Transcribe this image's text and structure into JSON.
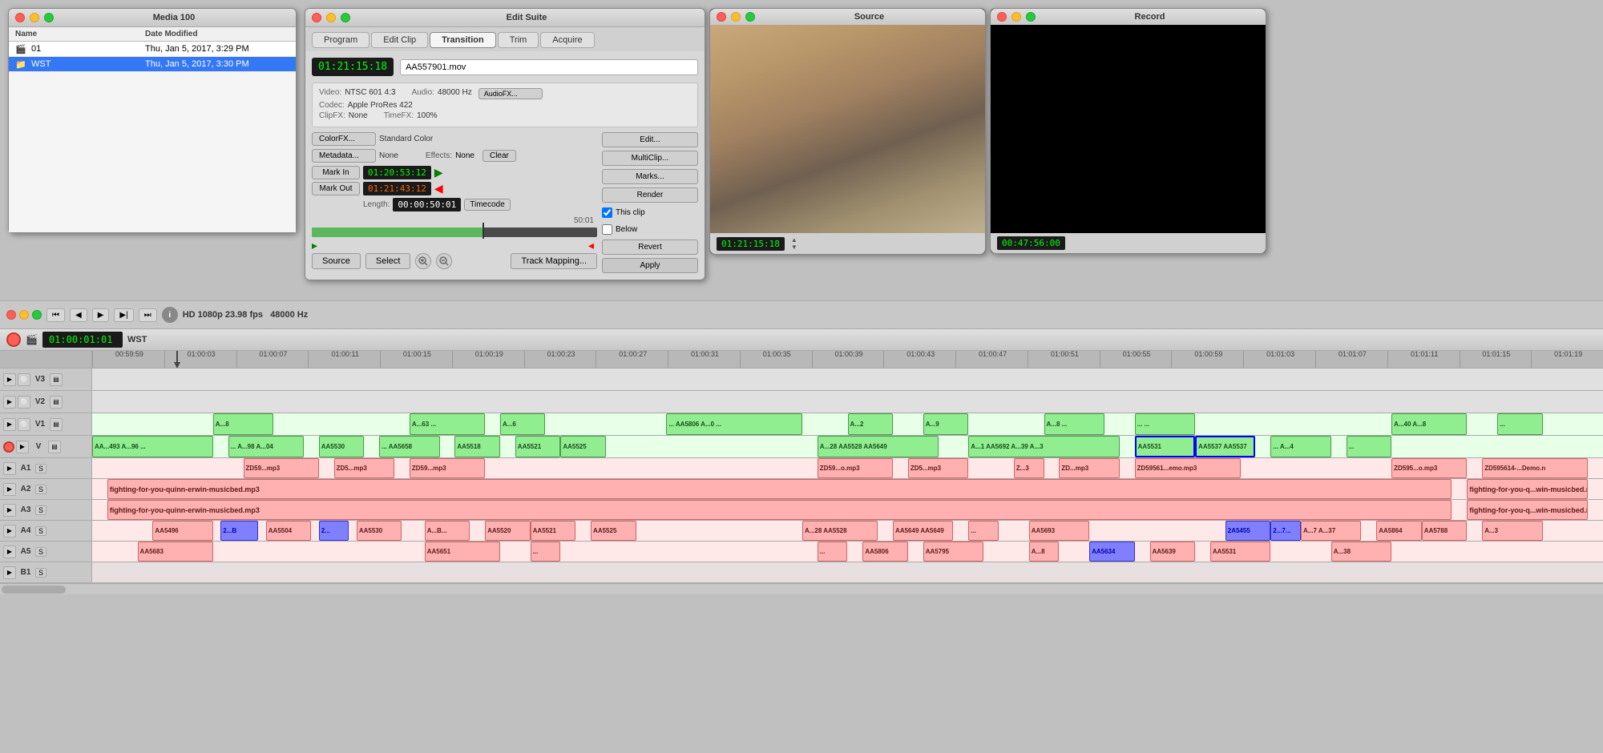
{
  "media_panel": {
    "title": "Media 100",
    "cols": [
      "Name",
      "Date Modified"
    ],
    "items": [
      {
        "name": "01",
        "date": "Thu, Jan 5, 2017, 3:29 PM",
        "type": "clip"
      },
      {
        "name": "WST",
        "date": "Thu, Jan 5, 2017, 3:30 PM",
        "type": "folder",
        "selected": true
      }
    ]
  },
  "edit_suite": {
    "title": "Edit Suite",
    "tabs": [
      "Program",
      "Edit Clip",
      "Transition",
      "Trim",
      "Acquire"
    ],
    "active_tab": "Transition",
    "timecode": "01:21:15:18",
    "clip_name": "AA557901.mov",
    "video_info": "NTSC 601 4:3",
    "codec": "Apple ProRes 422",
    "clip_fx": "None",
    "audio": "48000 Hz",
    "time_fx": "100%",
    "color_fx_label": "ColorFX...",
    "color_fx_value": "Standard Color",
    "metadata_label": "Metadata...",
    "metadata_value": "None",
    "effects_label": "Effects:",
    "effects_value": "None",
    "clear_label": "Clear",
    "mark_in_label": "Mark In",
    "mark_in_tc": "01:20:53:12",
    "mark_out_label": "Mark Out",
    "mark_out_tc": "01:21:43:12",
    "length_label": "Length:",
    "length_tc": "00:00:50:01",
    "timecode_type": "Timecode",
    "scrubber_max": "50:01",
    "source_label": "Source",
    "select_label": "Select",
    "track_mapping_label": "Track Mapping...",
    "audio_fx_label": "AudioFX...",
    "edit_label": "Edit...",
    "multiclip_label": "MultiClip...",
    "marks_label": "Marks...",
    "render_label": "Render",
    "this_clip_label": "This clip",
    "below_label": "Below",
    "revert_label": "Revert",
    "apply_label": "Apply"
  },
  "source_monitor": {
    "title": "Source",
    "timecode": "01:21:15:18"
  },
  "record_monitor": {
    "title": "Record",
    "timecode": "00:47:56:00"
  },
  "timeline": {
    "title": "WST",
    "format": "HD 1080p 23.98 fps",
    "audio_rate": "48000 Hz",
    "timecode": "01:00:01:01",
    "ruler_marks": [
      "00:59:59",
      "01:00:03",
      "01:00:07",
      "01:00:11",
      "01:00:15",
      "01:00:19",
      "01:00:23",
      "01:00:27",
      "01:00:31",
      "01:00:35",
      "01:00:39",
      "01:00:43",
      "01:00:47",
      "01:00:51",
      "01:00:55",
      "01:00:59",
      "01:01:03",
      "01:01:07",
      "01:01:11",
      "01:01:15",
      "01:01:19"
    ],
    "tracks": [
      {
        "name": "V3",
        "type": "v",
        "clips": []
      },
      {
        "name": "V2",
        "type": "v",
        "clips": []
      },
      {
        "name": "V1",
        "type": "v",
        "clips": [
          {
            "label": "A...8",
            "color": "green",
            "left": "20%",
            "width": "4%"
          },
          {
            "label": "A...63 ...",
            "color": "green",
            "left": "36%",
            "width": "4%"
          },
          {
            "label": "A...6",
            "color": "green",
            "left": "41%",
            "width": "3%"
          },
          {
            "label": "... AA5806 A...0 ... ... A...2",
            "color": "green",
            "left": "52%",
            "width": "8%"
          },
          {
            "label": "A...9",
            "color": "green",
            "left": "61%",
            "width": "3%"
          },
          {
            "label": "A...8 ...",
            "color": "green",
            "left": "68%",
            "width": "5%"
          },
          {
            "label": "... ...",
            "color": "green",
            "left": "74%",
            "width": "3%"
          },
          {
            "label": "A...40 A...8",
            "color": "green",
            "left": "86%",
            "width": "5%"
          },
          {
            "label": "...",
            "color": "green",
            "left": "92%",
            "width": "3%"
          }
        ]
      },
      {
        "name": "V",
        "type": "v",
        "record": true,
        "clips": [
          {
            "label": "AA... A...493 A...96 ...",
            "color": "green",
            "left": "0%",
            "width": "14%"
          },
          {
            "label": "... A...98 A...04",
            "color": "green",
            "left": "14%",
            "width": "5%"
          },
          {
            "label": "AA5530",
            "color": "green",
            "left": "21%",
            "width": "4%"
          },
          {
            "label": "... AA5658 ...",
            "color": "green",
            "left": "26%",
            "width": "4%"
          },
          {
            "label": "AA5518",
            "color": "green",
            "left": "30%",
            "width": "3%"
          },
          {
            "label": "AA5521",
            "color": "green",
            "left": "33%",
            "width": "3%"
          },
          {
            "label": "AA5525",
            "color": "green",
            "left": "37%",
            "width": "3%"
          },
          {
            "label": "A...28 AA5528 AA5649",
            "color": "green",
            "left": "53%",
            "width": "7%"
          },
          {
            "label": "A...1 AA5692 A...39 A...3 ... AA5531",
            "color": "green",
            "left": "66%",
            "width": "9%"
          },
          {
            "label": "AA5537 AA5537",
            "color": "green-selected",
            "left": "76%",
            "width": "6%"
          },
          {
            "label": "... A...4",
            "color": "green",
            "left": "82%",
            "width": "4%"
          },
          {
            "label": "...",
            "color": "green",
            "left": "88%",
            "width": "3%"
          }
        ]
      },
      {
        "name": "A1",
        "type": "a",
        "clips": [
          {
            "label": "ZD59...mp3",
            "color": "pink",
            "left": "12%",
            "width": "5%"
          },
          {
            "label": "ZD5...mp3",
            "color": "pink",
            "left": "17%",
            "width": "4%"
          },
          {
            "label": "ZD59...mp3",
            "color": "pink",
            "left": "22%",
            "width": "5%"
          },
          {
            "label": "ZD59...o.mp3 ZD5...mp3",
            "color": "pink",
            "left": "50%",
            "width": "7%"
          },
          {
            "label": "Z...3",
            "color": "pink",
            "left": "62%",
            "width": "2%"
          },
          {
            "label": "ZD...mp3",
            "color": "pink",
            "left": "65%",
            "width": "4%"
          },
          {
            "label": "ZD59561...emo.mp3",
            "color": "pink",
            "left": "70%",
            "width": "7%"
          },
          {
            "label": "ZD595...o.mp3",
            "color": "pink",
            "left": "88%",
            "width": "5%"
          },
          {
            "label": "ZD595614-...Demo.m",
            "color": "pink",
            "left": "93%",
            "width": "5%"
          }
        ]
      },
      {
        "name": "A2",
        "type": "a",
        "clips": [
          {
            "label": "fighting-for-you-quinn-erwin-musicbed.mp3",
            "color": "pink",
            "left": "0%",
            "width": "91%"
          },
          {
            "label": "fighting-for-you-q...win-musicbed.n",
            "color": "pink",
            "left": "92%",
            "width": "8%"
          }
        ]
      },
      {
        "name": "A3",
        "type": "a",
        "clips": [
          {
            "label": "fighting-for-you-quinn-erwin-musicbed.mp3",
            "color": "pink",
            "left": "0%",
            "width": "91%"
          },
          {
            "label": "fighting-for-you-q...win-musicbed.n",
            "color": "pink",
            "left": "92%",
            "width": "8%"
          }
        ]
      },
      {
        "name": "A4",
        "type": "a",
        "clips": [
          {
            "label": "AA5496",
            "color": "pink",
            "left": "5%",
            "width": "4%"
          },
          {
            "label": "2...B",
            "color": "blue",
            "left": "9%",
            "width": "2%"
          },
          {
            "label": "AA5504 2...",
            "color": "pink",
            "left": "11%",
            "width": "3%"
          },
          {
            "label": "AA5530",
            "color": "pink",
            "left": "15%",
            "width": "4%"
          },
          {
            "label": "A...B...",
            "color": "pink",
            "left": "22%",
            "width": "3%"
          },
          {
            "label": "AA5520",
            "color": "pink",
            "left": "25%",
            "width": "4%"
          },
          {
            "label": "AA5521",
            "color": "pink",
            "left": "29%",
            "width": "3%"
          },
          {
            "label": "AA5525",
            "color": "pink",
            "left": "33%",
            "width": "3%"
          },
          {
            "label": "A...28 AA5528 AA5649 AA5649",
            "color": "pink",
            "left": "53%",
            "width": "8%"
          },
          {
            "label": "...",
            "color": "pink",
            "left": "61%",
            "width": "2%"
          },
          {
            "label": "AA5693",
            "color": "pink",
            "left": "65%",
            "width": "4%"
          },
          {
            "label": "...2A5455 2...7... A...7 A...37",
            "color": "blue-pink",
            "left": "76%",
            "width": "8%"
          },
          {
            "label": "AA5864 AA5788",
            "color": "pink",
            "left": "86%",
            "width": "5%"
          },
          {
            "label": "A...3",
            "color": "pink",
            "left": "92%",
            "width": "4%"
          }
        ]
      },
      {
        "name": "A5",
        "type": "a",
        "clips": [
          {
            "label": "AA5683",
            "color": "pink",
            "left": "3%",
            "width": "5%"
          },
          {
            "label": "AA5651",
            "color": "pink",
            "left": "22%",
            "width": "5%"
          },
          {
            "label": "...",
            "color": "pink",
            "left": "29%",
            "width": "2%"
          },
          {
            "label": "...",
            "color": "pink",
            "left": "48%",
            "width": "2%"
          },
          {
            "label": "AA5806",
            "color": "pink",
            "left": "52%",
            "width": "3%"
          },
          {
            "label": "AA5795",
            "color": "pink",
            "left": "56%",
            "width": "4%"
          },
          {
            "label": "A...8",
            "color": "pink",
            "left": "63%",
            "width": "2%"
          },
          {
            "label": "AA5634",
            "color": "pink",
            "left": "67%",
            "width": "3%"
          },
          {
            "label": "AA5639",
            "color": "pink",
            "left": "71%",
            "width": "3%"
          },
          {
            "label": "AA5531",
            "color": "pink",
            "left": "75%",
            "width": "4%"
          },
          {
            "label": "A...38",
            "color": "pink",
            "left": "83%",
            "width": "4%"
          }
        ]
      },
      {
        "name": "B1",
        "type": "b",
        "clips": []
      }
    ]
  }
}
